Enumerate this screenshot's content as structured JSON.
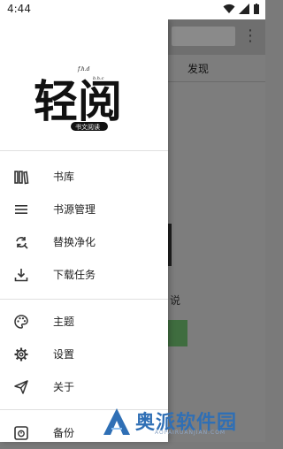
{
  "status_bar": {
    "time": "4:44"
  },
  "drawer": {
    "logo": {
      "title": "轻阅",
      "subtitle": "书文阅读",
      "small_text_1": "f.h.d",
      "small_text_2": "b.h.c"
    },
    "groups": [
      [
        {
          "label": "书库",
          "icon": "bookshelf-icon"
        },
        {
          "label": "书源管理",
          "icon": "list-icon"
        },
        {
          "label": "替换净化",
          "icon": "replace-sync-icon"
        },
        {
          "label": "下载任务",
          "icon": "download-icon"
        }
      ],
      [
        {
          "label": "主题",
          "icon": "palette-icon"
        },
        {
          "label": "设置",
          "icon": "gear-icon"
        },
        {
          "label": "关于",
          "icon": "send-icon"
        }
      ],
      [
        {
          "label": "备份",
          "icon": "backup-icon"
        }
      ]
    ]
  },
  "background": {
    "tab_label": "发现",
    "partial_text": "说"
  },
  "watermark": {
    "text": "奥派软件园",
    "sub": "AOPAIRUANJIAN.COM"
  },
  "colors": {
    "accent_green": "#3f6d3f",
    "watermark_blue": "#2f6fb5",
    "overlay_gray": "#7d7d7d"
  }
}
